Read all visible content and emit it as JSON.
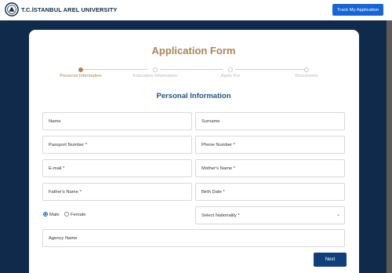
{
  "header": {
    "brand": "T.C.İSTANBUL AREL UNIVERSITY",
    "logo_icon": "university-seal-icon",
    "track_button": "Track My Application"
  },
  "form": {
    "title": "Application Form",
    "steps": [
      {
        "label": "Personal Information",
        "state": "active"
      },
      {
        "label": "Education Information",
        "state": "inactive"
      },
      {
        "label": "Apply For",
        "state": "inactive"
      },
      {
        "label": "Documents",
        "state": "inactive"
      }
    ],
    "section_title": "Personal Information",
    "fields": {
      "name": "Name",
      "surname": "Surname",
      "passport": "Passport Number *",
      "phone": "Phone Number *",
      "email": "E-mail *",
      "mother": "Mother's Name *",
      "father": "Father's Name *",
      "birth": "Birth Date *",
      "nationality": "Select Nationality *",
      "agency": "Agency Name"
    },
    "gender": {
      "options": [
        "Male",
        "Female"
      ],
      "selected": "Male"
    },
    "next_button": "Next"
  },
  "colors": {
    "navy": "#0f2a4a",
    "gold": "#a88656",
    "blue": "#1565d8",
    "section_blue": "#1f5291",
    "next": "#0f3f7a"
  }
}
